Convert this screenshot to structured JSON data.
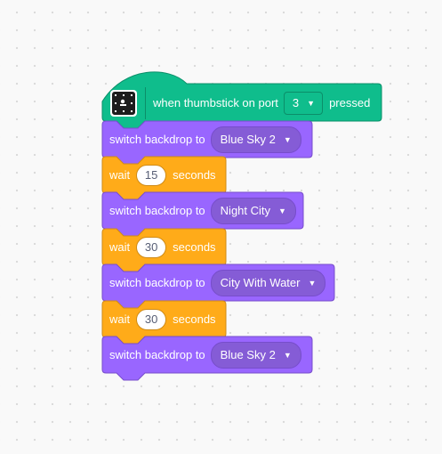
{
  "colors": {
    "events_ext": "#0fbd8c",
    "events_ext_border": "#0b8e69",
    "looks": "#9966ff",
    "looks_border": "#774dcb",
    "looks_menu": "#855cd6",
    "control": "#ffab19",
    "control_border": "#cf8b17"
  },
  "hat_block": {
    "icon": "thumbstick-device-icon",
    "label_before": "when thumbstick on port",
    "port_value": "3",
    "label_after": "pressed"
  },
  "blocks": [
    {
      "type": "looks",
      "label": "switch backdrop to",
      "value": "Blue Sky 2"
    },
    {
      "type": "control",
      "label": "wait",
      "value": "15",
      "suffix": "seconds"
    },
    {
      "type": "looks",
      "label": "switch backdrop to",
      "value": "Night City"
    },
    {
      "type": "control",
      "label": "wait",
      "value": "30",
      "suffix": "seconds"
    },
    {
      "type": "looks",
      "label": "switch backdrop to",
      "value": "City With Water"
    },
    {
      "type": "control",
      "label": "wait",
      "value": "30",
      "suffix": "seconds"
    },
    {
      "type": "looks",
      "label": "switch backdrop to",
      "value": "Blue Sky 2"
    }
  ],
  "caret_glyph": "▼"
}
